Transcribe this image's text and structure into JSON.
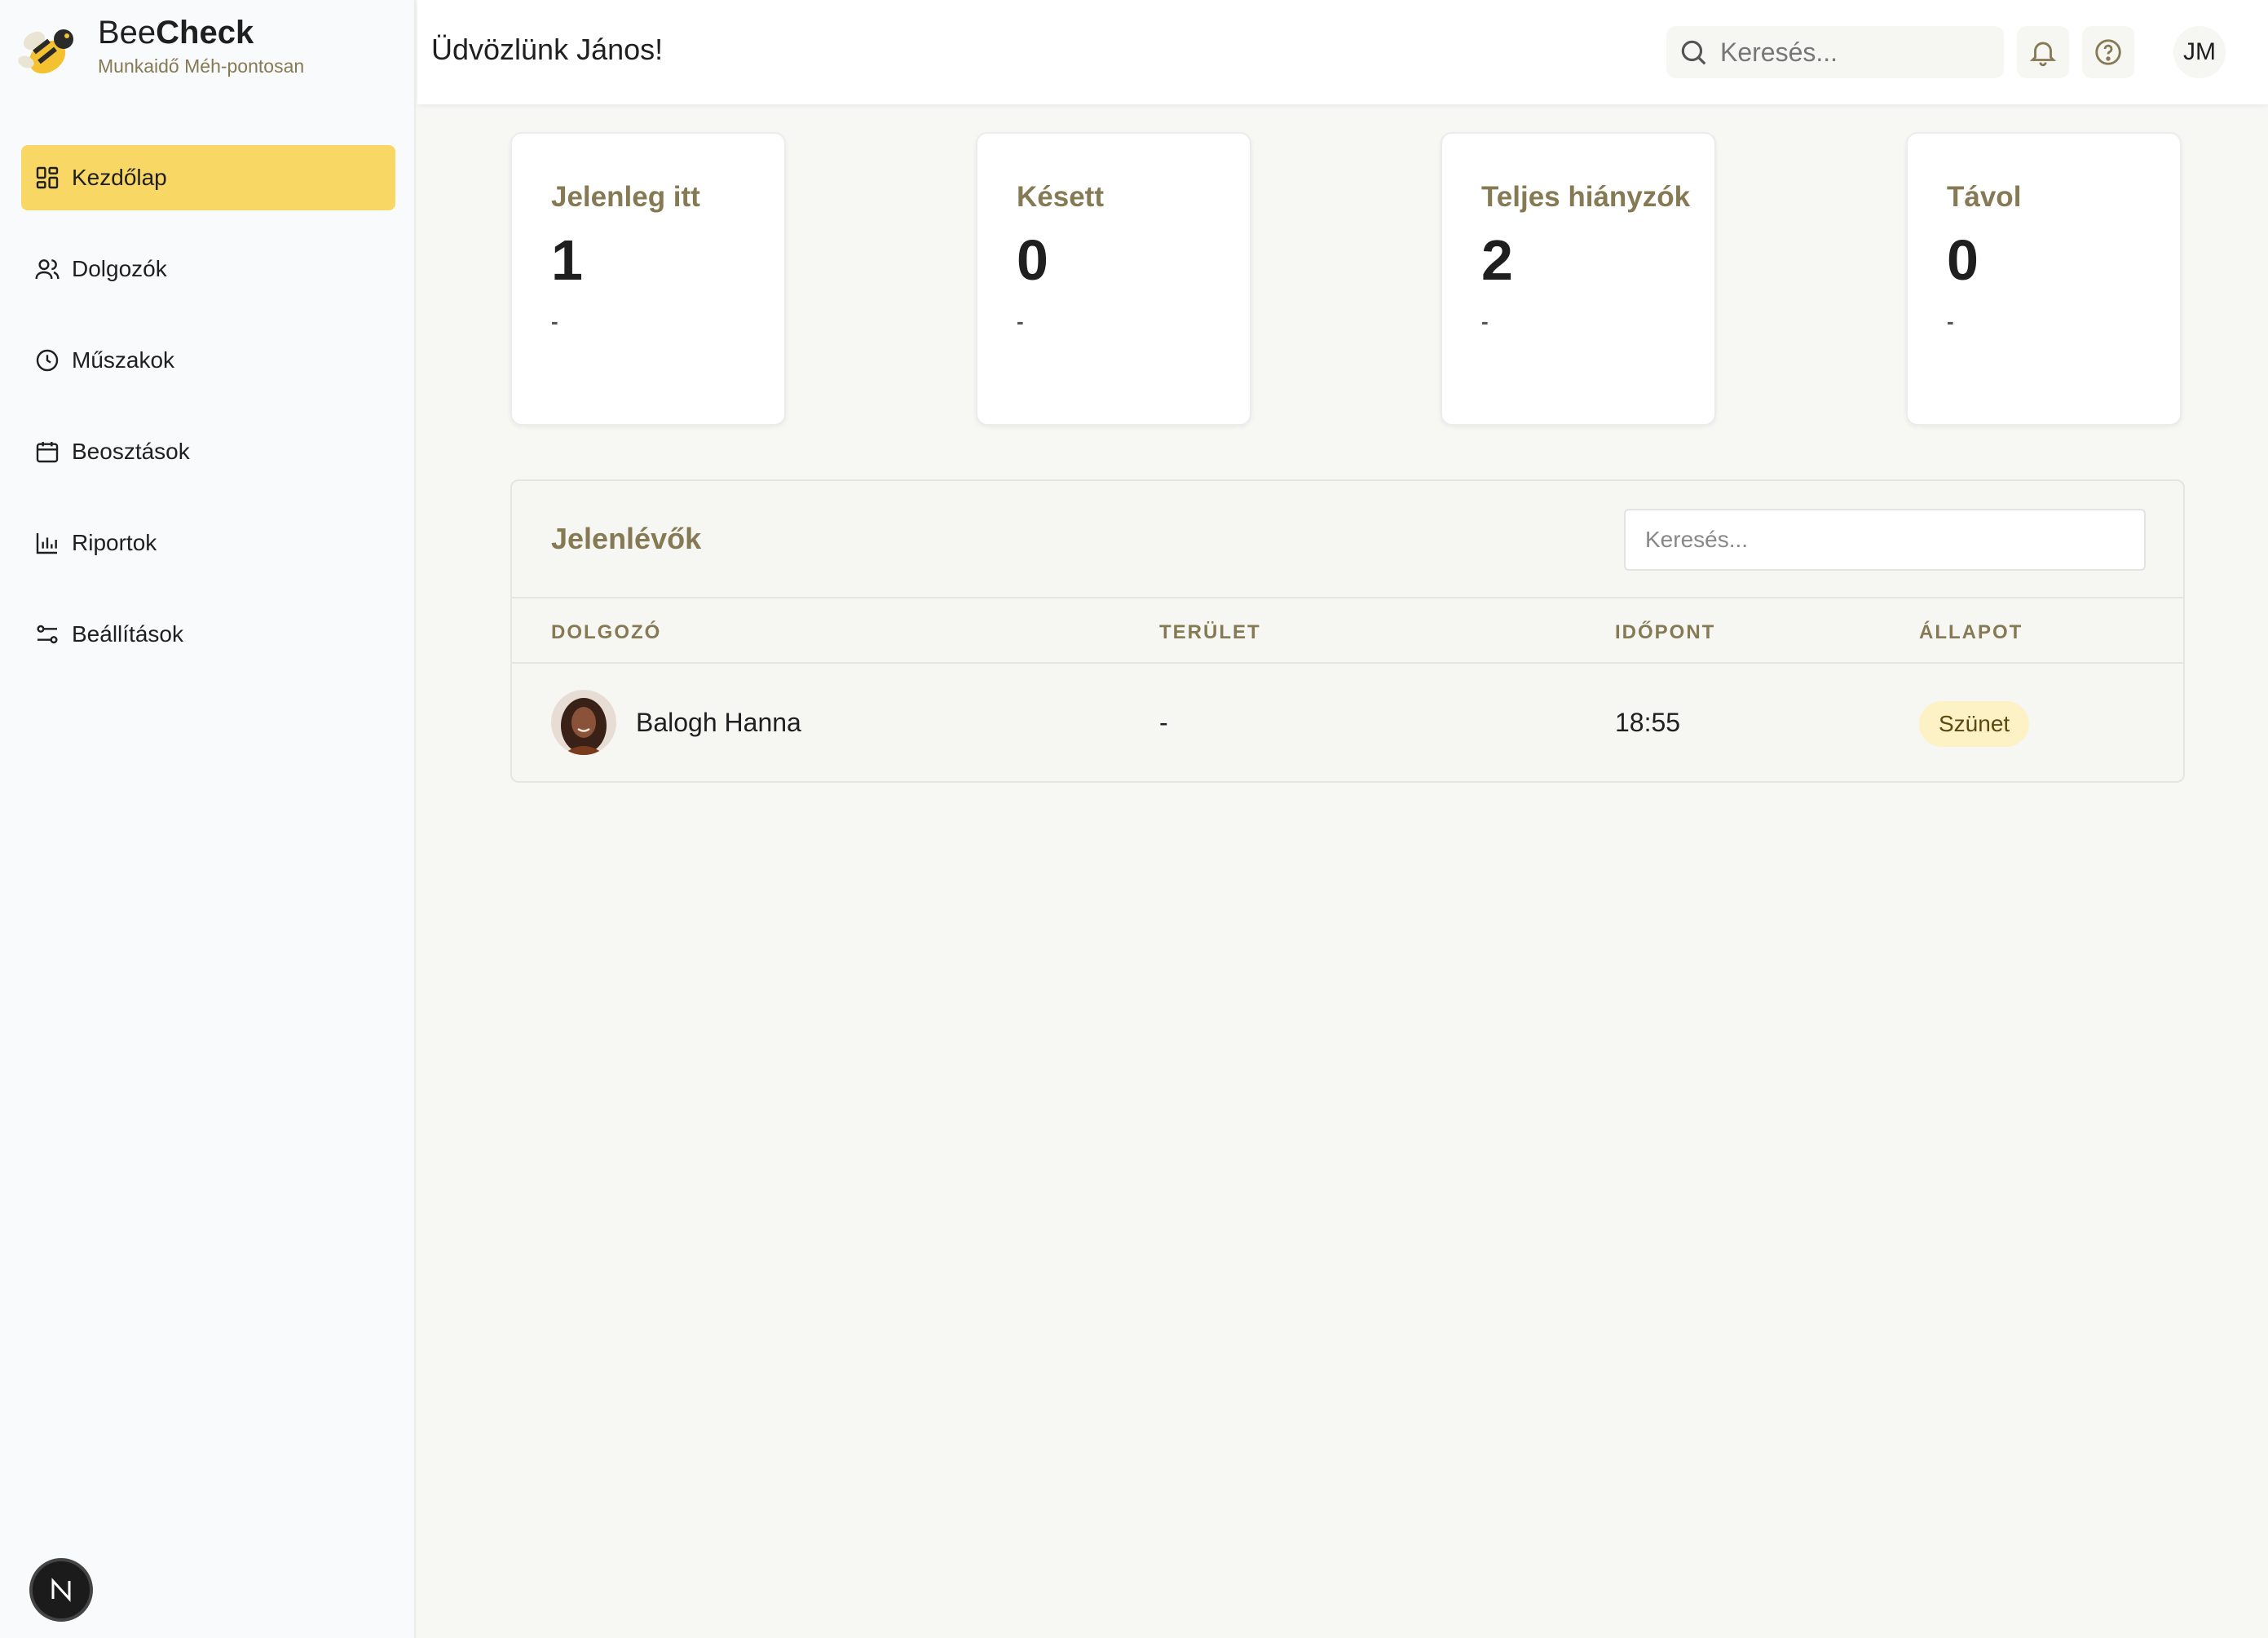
{
  "brand": {
    "name_part1": "Bee",
    "name_part2": "Check",
    "tagline": "Munkaidő Méh-pontosan"
  },
  "sidebar": {
    "items": [
      {
        "label": "Kezdőlap",
        "icon": "dashboard-icon",
        "active": true
      },
      {
        "label": "Dolgozók",
        "icon": "users-icon"
      },
      {
        "label": "Műszakok",
        "icon": "clock-icon"
      },
      {
        "label": "Beosztások",
        "icon": "calendar-icon"
      },
      {
        "label": "Riportok",
        "icon": "bar-chart-icon"
      },
      {
        "label": "Beállítások",
        "icon": "settings-sliders-icon"
      }
    ],
    "footer_badge": "N"
  },
  "header": {
    "welcome": "Üdvözlünk János!",
    "search_placeholder": "Keresés...",
    "user_initials": "JM"
  },
  "stats": [
    {
      "title": "Jelenleg itt",
      "value": "1",
      "sub": "-"
    },
    {
      "title": "Késett",
      "value": "0",
      "sub": "-"
    },
    {
      "title": "Teljes hiányzók",
      "value": "2",
      "sub": "-"
    },
    {
      "title": "Távol",
      "value": "0",
      "sub": "-"
    }
  ],
  "attendees": {
    "title": "Jelenlévők",
    "search_placeholder": "Keresés...",
    "columns": [
      "DOLGOZÓ",
      "TERÜLET",
      "IDŐPONT",
      "ÁLLAPOT"
    ],
    "rows": [
      {
        "name": "Balogh Hanna",
        "area": "-",
        "time": "18:55",
        "status": "Szünet"
      }
    ]
  },
  "colors": {
    "accent": "#f9d764",
    "label_brown": "#857a54",
    "status_badge_bg": "#fdf2c5"
  }
}
